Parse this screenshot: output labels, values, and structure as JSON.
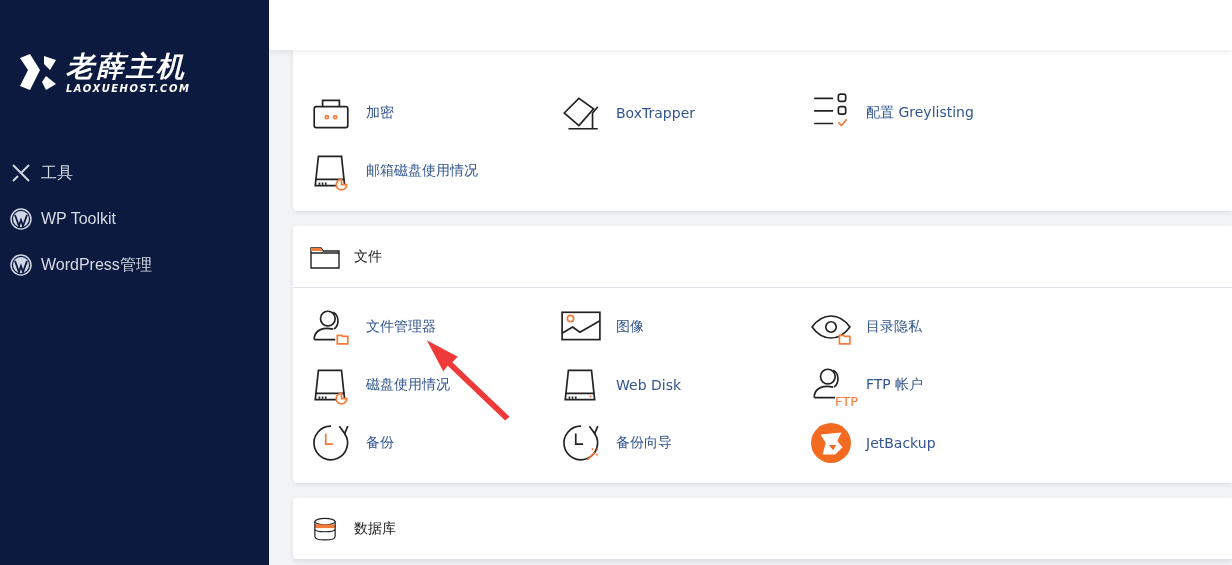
{
  "sidebar": {
    "logo": {
      "title": "老薛主机",
      "subtitle": "LAOXUEHOST.COM"
    },
    "items": [
      {
        "label": "工具"
      },
      {
        "label": "WP Toolkit"
      },
      {
        "label": "WordPress管理"
      }
    ]
  },
  "sections": [
    {
      "items": [
        {
          "label": "加密"
        },
        {
          "label": "BoxTrapper"
        },
        {
          "label": "配置 Greylisting"
        },
        {
          "label": "邮箱磁盘使用情况"
        }
      ]
    },
    {
      "title": "文件",
      "items": [
        {
          "label": "文件管理器"
        },
        {
          "label": "图像"
        },
        {
          "label": "目录隐私"
        },
        {
          "label": "磁盘使用情况"
        },
        {
          "label": "Web Disk"
        },
        {
          "label": "FTP 帐户",
          "icon_text": "FTP"
        },
        {
          "label": "备份"
        },
        {
          "label": "备份向导"
        },
        {
          "label": "JetBackup"
        }
      ]
    },
    {
      "title": "数据库"
    }
  ]
}
